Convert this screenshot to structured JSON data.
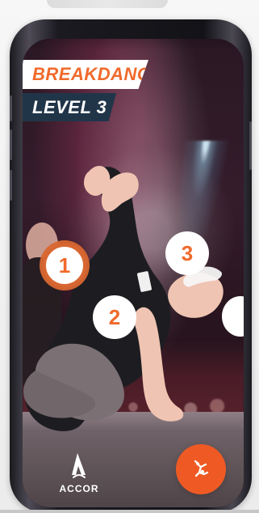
{
  "screen": {
    "title_primary": "BREAKDANCE",
    "title_secondary": "LEVEL 3"
  },
  "hotspots": [
    {
      "label": "1"
    },
    {
      "label": "2"
    },
    {
      "label": "3"
    }
  ],
  "brand": {
    "name": "ACCOR"
  },
  "action": {
    "icon": "breakdance-pose-icon"
  },
  "colors": {
    "accent_orange": "#f06a2b",
    "title_navy": "#213549",
    "screen_bg": "#261722"
  }
}
